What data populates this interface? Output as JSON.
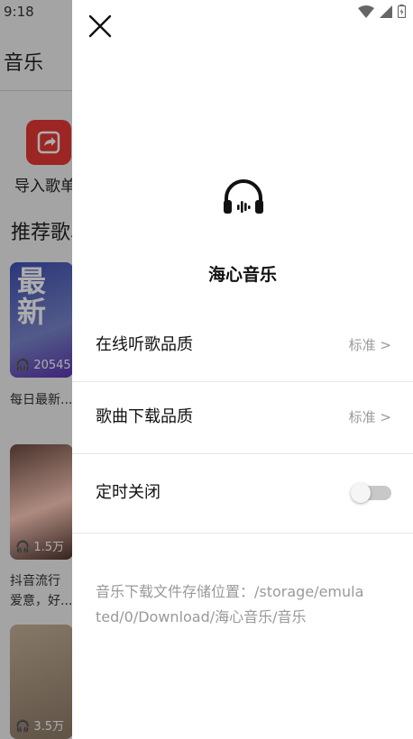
{
  "status_bar": {
    "time": "9:18"
  },
  "background_app": {
    "title": "音乐",
    "import_label": "导入歌单",
    "recommend_title": "推荐歌单",
    "cards": [
      {
        "cover_text": "最新",
        "play_count": "20545",
        "caption": "每日最新..."
      },
      {
        "play_count": "1.5万",
        "caption": "抖音流行\n爱意，好..."
      },
      {
        "play_count": "3.5万"
      }
    ]
  },
  "drawer": {
    "app_name": "海心音乐",
    "settings": [
      {
        "label": "在线听歌品质",
        "value": "标准 >"
      },
      {
        "label": "歌曲下载品质",
        "value": "标准 >"
      },
      {
        "label": "定时关闭",
        "toggle_on": false
      }
    ],
    "storage_text": "音乐下载文件存储位置：/storage/emulated/0/Download/海心音乐/音乐"
  }
}
